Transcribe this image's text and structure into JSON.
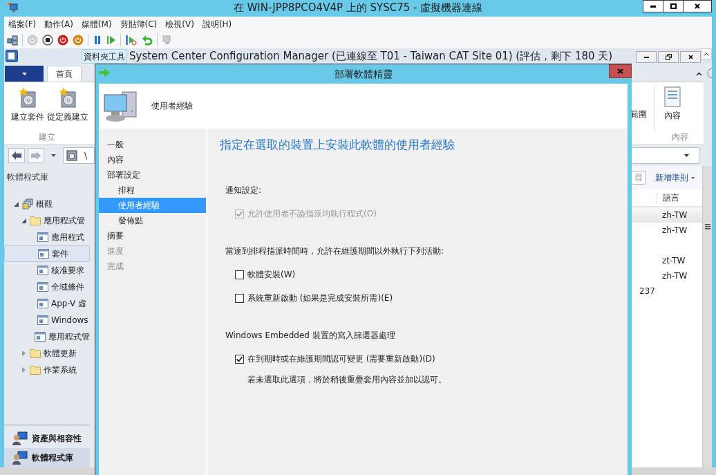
{
  "vm_window": {
    "title": "在 WIN-JPP8PCO4V4P 上的 SYSC75 - 虛擬機器連線"
  },
  "menu": [
    "檔案(F)",
    "動作(A)",
    "媒體(M)",
    "剪貼簿(C)",
    "檢視(V)",
    "說明(H)"
  ],
  "sccm": {
    "contextual_tab": "資料夾工具",
    "title": "System Center Configuration Manager (已連線至 T01 - Taiwan CAT Site 01) (評估，剩下 180 天)",
    "ribbon_tabs": [
      {
        "label": "首頁",
        "selected": true
      }
    ],
    "ribbon_left": {
      "buttons": [
        "建立套件",
        "從定義建立"
      ],
      "group": "建立"
    },
    "ribbon_right": {
      "buttons": [
        "範圍",
        "內容"
      ],
      "group": "內容"
    },
    "address": "\\",
    "nav_title": "軟體程式庫",
    "tree": [
      {
        "label": "概觀",
        "kind": "overview",
        "expanded": true,
        "selected": false,
        "children": [
          {
            "label": "應用程式管",
            "kind": "folder",
            "expanded": true,
            "selected": false,
            "children": [
              {
                "label": "應用程式",
                "kind": "item",
                "selected": false
              },
              {
                "label": "套件",
                "kind": "item",
                "selected": true
              },
              {
                "label": "核准要求",
                "kind": "item",
                "selected": false
              },
              {
                "label": "全域條件",
                "kind": "item",
                "selected": false
              },
              {
                "label": "App-V 虛",
                "kind": "item",
                "selected": false
              },
              {
                "label": "Windows",
                "kind": "item",
                "selected": false
              },
              {
                "label": "應用程式管",
                "kind": "item",
                "selected": false
              }
            ]
          },
          {
            "label": "軟體更新",
            "kind": "folder",
            "expanded": false,
            "selected": false
          },
          {
            "label": "作業系統",
            "kind": "folder",
            "expanded": false,
            "selected": false
          }
        ]
      }
    ],
    "workspaces": [
      {
        "label": "資產與相容性",
        "selected": false
      },
      {
        "label": "軟體程式庫",
        "selected": true
      }
    ],
    "search_button": "尋",
    "add_criteria": "新增準則",
    "columns": [
      "語言"
    ],
    "rows": [
      {
        "language": "zh-TW",
        "selected": true
      },
      {
        "language": "zh-TW",
        "selected": false
      },
      {
        "selected": false
      },
      {
        "language": "zt-TW",
        "selected": false
      },
      {
        "language": "zh-TW",
        "selected": false
      },
      {
        "column_1": "237",
        "selected": false
      }
    ]
  },
  "wizard": {
    "title": "部署軟體精靈",
    "header": "使用者經驗",
    "steps": [
      {
        "label": "一般",
        "selected": false,
        "disabled": false
      },
      {
        "label": "內容",
        "selected": false,
        "disabled": false
      },
      {
        "label": "部署設定",
        "selected": false,
        "disabled": false,
        "children": [
          {
            "label": "排程",
            "selected": false,
            "disabled": false
          },
          {
            "label": "使用者經驗",
            "selected": true,
            "disabled": false
          },
          {
            "label": "發佈點",
            "selected": false,
            "disabled": false
          }
        ]
      },
      {
        "label": "摘要",
        "selected": false,
        "disabled": false
      },
      {
        "label": "進度",
        "selected": false,
        "disabled": true
      },
      {
        "label": "完成",
        "selected": false,
        "disabled": true
      }
    ],
    "heading": "指定在選取的裝置上安裝此軟體的使用者經驗",
    "items": [
      {
        "kind": "label",
        "text": "通知設定:"
      },
      {
        "kind": "checkbox",
        "text": "允許使用者不論指派均執行程式(O)",
        "checked": true,
        "disabled": true
      },
      {
        "kind": "label",
        "text": "當達到排程指派時間時，允許在維護期間以外執行下列活動:"
      },
      {
        "kind": "checkbox",
        "text": "軟體安裝(W)",
        "checked": false,
        "disabled": false
      },
      {
        "kind": "checkbox",
        "text": "系統重新啟動 (如果是完成安裝所需)(E)",
        "checked": false,
        "disabled": false
      },
      {
        "kind": "label",
        "text": "Windows Embedded 裝置的寫入篩選器處理"
      },
      {
        "kind": "checkbox",
        "text": "在到期時或在維護期間認可變更 (需要重新啟動)(D)",
        "checked": true,
        "disabled": false
      },
      {
        "kind": "note",
        "text": "若未選取此選項，將於稍後重疊套用內容並加以認可。"
      }
    ]
  }
}
